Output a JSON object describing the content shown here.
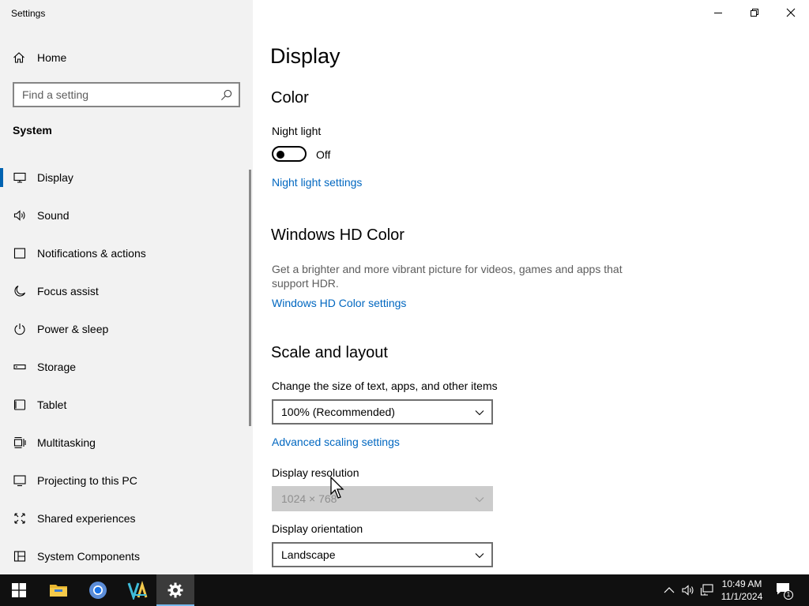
{
  "window": {
    "title": "Settings"
  },
  "sidebar": {
    "home_label": "Home",
    "search_placeholder": "Find a setting",
    "section_title": "System",
    "items": [
      {
        "label": "Display",
        "icon": "monitor-icon",
        "active": true
      },
      {
        "label": "Sound",
        "icon": "speaker-icon"
      },
      {
        "label": "Notifications & actions",
        "icon": "notification-icon"
      },
      {
        "label": "Focus assist",
        "icon": "moon-icon"
      },
      {
        "label": "Power & sleep",
        "icon": "power-icon"
      },
      {
        "label": "Storage",
        "icon": "storage-icon"
      },
      {
        "label": "Tablet",
        "icon": "tablet-icon"
      },
      {
        "label": "Multitasking",
        "icon": "multitasking-icon"
      },
      {
        "label": "Projecting to this PC",
        "icon": "projecting-icon"
      },
      {
        "label": "Shared experiences",
        "icon": "shared-experiences-icon"
      },
      {
        "label": "System Components",
        "icon": "system-components-icon"
      }
    ]
  },
  "main": {
    "title": "Display",
    "color": {
      "heading": "Color",
      "night_light_label": "Night light",
      "night_light_state": "Off",
      "night_light_link": "Night light settings"
    },
    "hd_color": {
      "heading": "Windows HD Color",
      "description": "Get a brighter and more vibrant picture for videos, games and apps that support HDR.",
      "link": "Windows HD Color settings"
    },
    "scale_layout": {
      "heading": "Scale and layout",
      "scale_label": "Change the size of text, apps, and other items",
      "scale_value": "100% (Recommended)",
      "advanced_link": "Advanced scaling settings",
      "resolution_label": "Display resolution",
      "resolution_value": "1024 × 768",
      "orientation_label": "Display orientation",
      "orientation_value": "Landscape"
    }
  },
  "taskbar": {
    "time": "10:49 AM",
    "date": "11/1/2024",
    "notification_count": "1"
  },
  "colors": {
    "accent": "#0067c0",
    "selection_bar": "#0063b1",
    "sidebar_bg": "#f2f2f2",
    "taskbar_bg": "#101010"
  }
}
